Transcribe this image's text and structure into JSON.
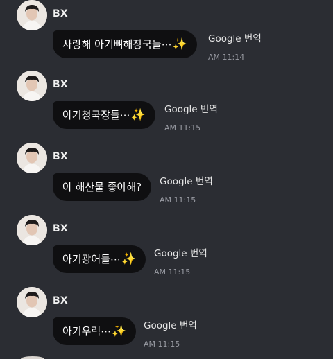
{
  "messages": [
    {
      "sender": "BX",
      "text": "사랑해 아기뼈해장국들⋯",
      "emoji": "✨",
      "translate_label": "Google 번역",
      "time": "AM 11:14"
    },
    {
      "sender": "BX",
      "text": "아기청국장들⋯",
      "emoji": "✨",
      "translate_label": "Google 번역",
      "time": "AM 11:15"
    },
    {
      "sender": "BX",
      "text": "아 해산물 좋아해?",
      "emoji": "",
      "translate_label": "Google 번역",
      "time": "AM 11:15"
    },
    {
      "sender": "BX",
      "text": "아기광어들⋯",
      "emoji": "✨",
      "translate_label": "Google 번역",
      "time": "AM 11:15"
    },
    {
      "sender": "BX",
      "text": "아기우럭⋯",
      "emoji": "✨",
      "translate_label": "Google 번역",
      "time": "AM 11:15"
    }
  ],
  "icons": {
    "avatar": "profile-photo",
    "sparkle": "sparkles-emoji"
  },
  "colors": {
    "background": "#2b2d33",
    "bubble": "#0f0f11",
    "time_text": "#9a9ca4"
  }
}
